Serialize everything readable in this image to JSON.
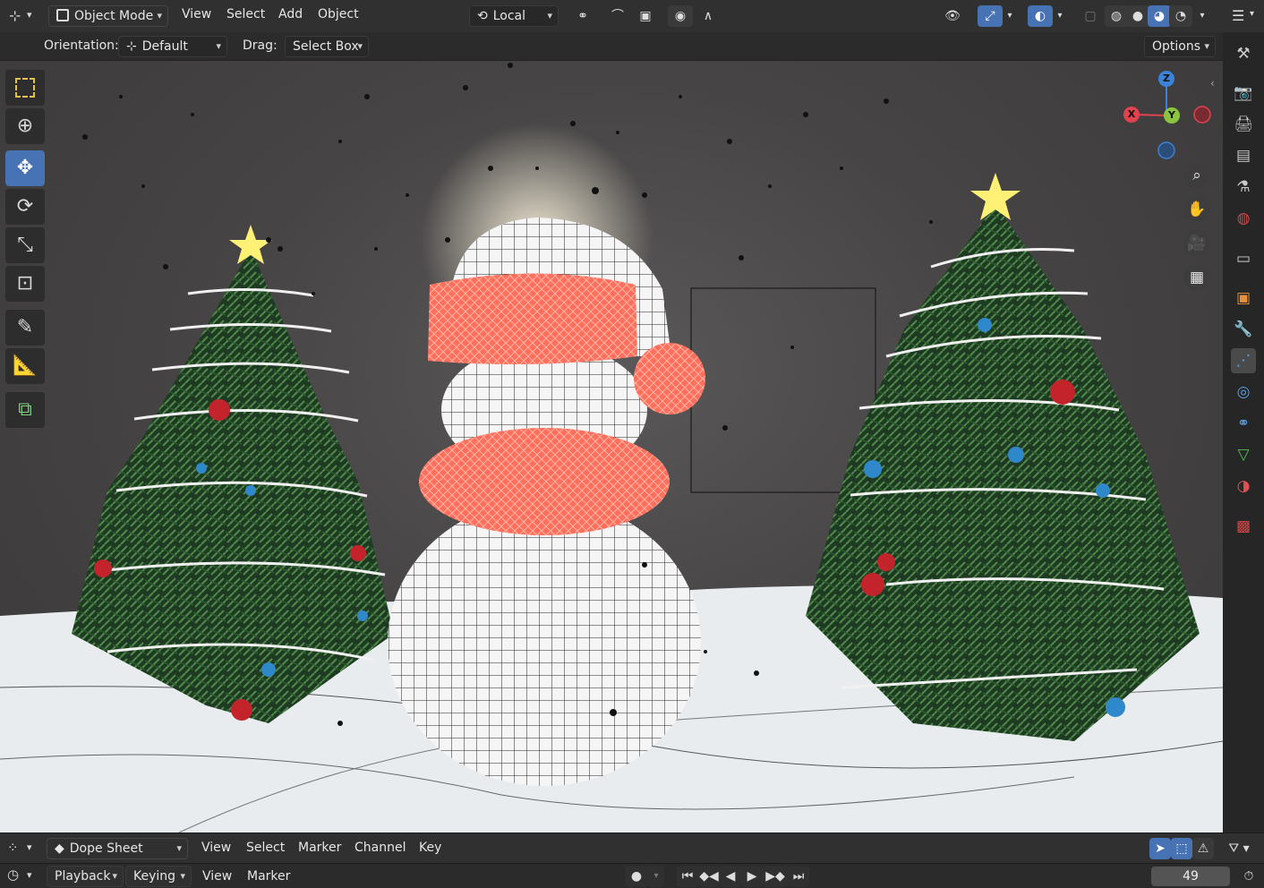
{
  "header": {
    "editor_type_icon": "axis-icon",
    "mode_label": "Object Mode",
    "menus": [
      "View",
      "Select",
      "Add",
      "Object"
    ],
    "transform_orientation": "Local",
    "icons": [
      "pivot-icon",
      "snap-icon",
      "proportional-edit-icon",
      "overlay-icon",
      "gizmo-icon",
      "xray-icon",
      "shading-wireframe-icon",
      "shading-solid-icon",
      "shading-material-icon",
      "shading-rendered-icon"
    ]
  },
  "tool_options": {
    "orientation_label": "Orientation:",
    "orientation_value": "Default",
    "drag_label": "Drag:",
    "drag_value": "Select Box",
    "options_label": "Options"
  },
  "toolbar": {
    "tools": [
      "select-box-tool",
      "cursor-tool",
      "move-tool",
      "rotate-tool",
      "scale-tool",
      "transform-tool",
      "annotate-tool",
      "measure-tool",
      "add-cube-tool"
    ],
    "active": "move-tool"
  },
  "gizmo": {
    "x_label": "X",
    "y_label": "Y",
    "z_label": "Z",
    "x_color": "#e0424f",
    "y_color": "#8bc53f",
    "z_color": "#3c82d8"
  },
  "properties_tabs": [
    "tool-icon",
    "render-icon",
    "output-icon",
    "view-layer-icon",
    "scene-icon",
    "world-icon",
    "collection-icon",
    "object-icon",
    "modifier-icon",
    "particles-icon",
    "physics-icon",
    "constraints-icon",
    "data-icon",
    "material-icon",
    "texture-icon"
  ],
  "dope_sheet": {
    "editor_label": "Dope Sheet",
    "menus": [
      "View",
      "Select",
      "Marker",
      "Channel",
      "Key"
    ]
  },
  "timeline": {
    "menus": [
      "Playback",
      "Keying",
      "View",
      "Marker"
    ],
    "current_frame": "49"
  },
  "colors": {
    "accent": "#4772b3",
    "header_bg": "#303030",
    "panel_bg": "#262626"
  }
}
